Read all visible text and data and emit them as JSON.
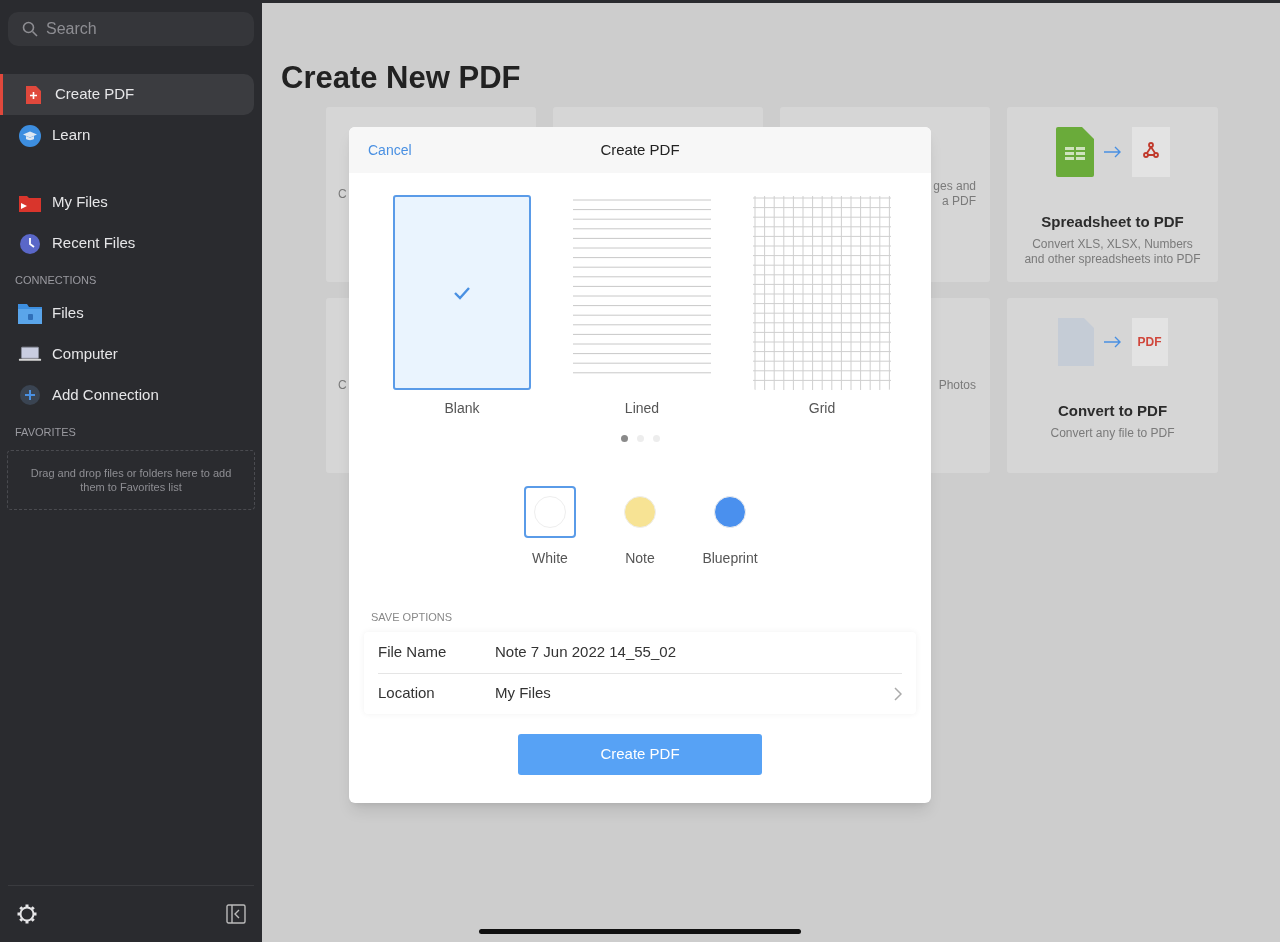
{
  "sidebar": {
    "search": {
      "placeholder": "Search"
    },
    "sections": [
      {
        "items": [
          {
            "label": "Create PDF",
            "kind": "pdf",
            "selected": true
          },
          {
            "label": "Learn",
            "kind": "learn",
            "selected": false
          }
        ]
      },
      {
        "items": [
          {
            "label": "My Files",
            "kind": "myfiles",
            "selected": false
          },
          {
            "label": "Recent Files",
            "kind": "recent",
            "selected": false
          }
        ]
      },
      {
        "heading": "CONNECTIONS",
        "items": [
          {
            "label": "Files",
            "kind": "files",
            "selected": false
          },
          {
            "label": "Computer",
            "kind": "computer",
            "selected": false
          },
          {
            "label": "Add Connection",
            "kind": "add",
            "selected": false
          }
        ]
      },
      {
        "heading": "FAVORITES",
        "dropzone": "Drag and drop files or folders here to add them to Favorites list"
      }
    ]
  },
  "main": {
    "title": "Create New PDF",
    "cards": [
      {
        "kind": "clipped_left",
        "lines": [
          "C"
        ]
      },
      {
        "kind": "hidden"
      },
      {
        "kind": "clipped_right",
        "lines": [
          "ges and",
          "a PDF"
        ]
      },
      {
        "kind": "spreadsheet",
        "title": "Spreadsheet to PDF",
        "description": "Convert XLS, XLSX, Numbers and other spreadsheets into PDF"
      },
      {
        "kind": "clipped_left",
        "lines": [
          "C"
        ]
      },
      {
        "kind": "clipped_right",
        "lines": [
          "Photos"
        ]
      },
      {
        "kind": "convert",
        "badge": "PDF",
        "title": "Convert to PDF",
        "description": "Convert any file to PDF"
      }
    ]
  },
  "dialog": {
    "cancel": "Cancel",
    "title": "Create PDF",
    "templates": [
      {
        "label": "Blank",
        "kind": "blank",
        "selected": true
      },
      {
        "label": "Lined",
        "kind": "lined",
        "selected": false
      },
      {
        "label": "Grid",
        "kind": "grid",
        "selected": false
      }
    ],
    "pages": [
      {
        "selected": true
      },
      {
        "selected": false
      },
      {
        "selected": false
      }
    ],
    "colors": [
      {
        "label": "White",
        "color": "#ffffff",
        "selected": true
      },
      {
        "label": "Note",
        "color": "#f7e394",
        "selected": false
      },
      {
        "label": "Blueprint",
        "color": "#4a90ee",
        "selected": false
      }
    ],
    "save_heading": "SAVE OPTIONS",
    "rows": [
      {
        "label": "File Name",
        "value": "Note 7 Jun 2022 14_55_02",
        "kind": "field"
      },
      {
        "label": "Location",
        "value": "My Files",
        "kind": "link"
      }
    ],
    "button": "Create PDF"
  }
}
